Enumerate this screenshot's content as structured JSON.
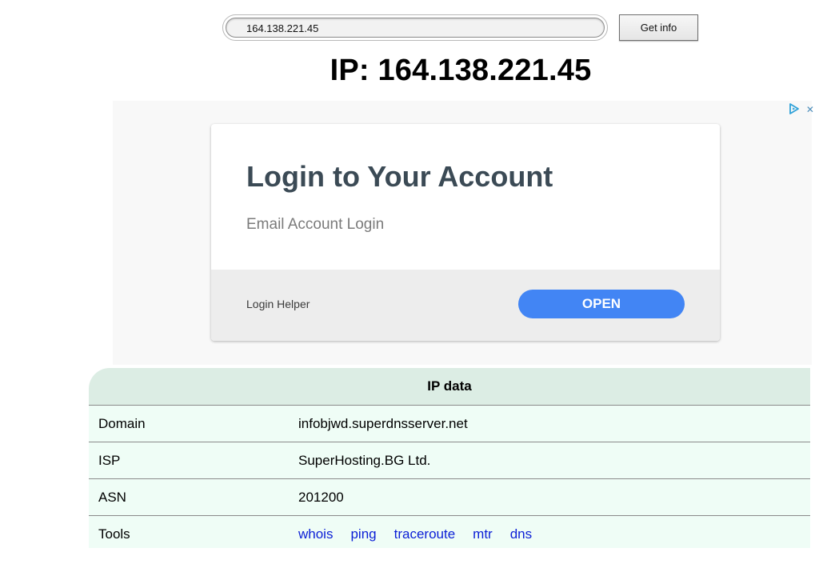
{
  "search": {
    "value": "164.138.221.45",
    "button_label": "Get info"
  },
  "heading": "IP: 164.138.221.45",
  "ad": {
    "choices_icon": "ad-choices-icon",
    "close_icon": "close-icon",
    "title": "Login to Your Account",
    "subtitle": "Email Account Login",
    "helper": "Login Helper",
    "cta_label": "OPEN",
    "cta_color": "#4285f4"
  },
  "ip_table": {
    "title": "IP data",
    "rows": [
      {
        "label": "Domain",
        "value": "infobjwd.superdnsserver.net"
      },
      {
        "label": "ISP",
        "value": "SuperHosting.BG Ltd."
      },
      {
        "label": "ASN",
        "value": "201200"
      }
    ],
    "tools": {
      "label": "Tools",
      "links": [
        "whois",
        "ping",
        "traceroute",
        "mtr",
        "dns"
      ]
    },
    "header_bg": "#dcede4",
    "row_bg": "#effdf6",
    "link_color": "#0b1fd6"
  }
}
